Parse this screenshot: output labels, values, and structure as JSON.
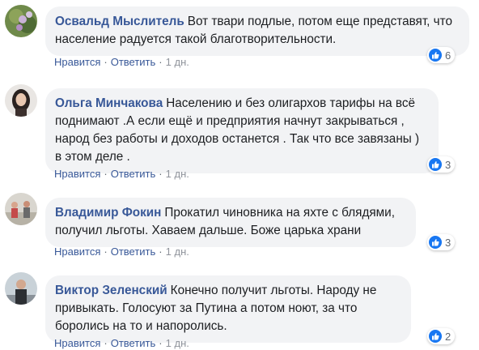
{
  "comments": [
    {
      "author": "Освальд Мыслитель",
      "text": "Вот твари подлые, потом еще представят, что население радуется такой благотворительности.",
      "actions": {
        "like": "Нравится",
        "reply": "Ответить",
        "separator": "·",
        "time": "1 дн."
      },
      "reactions": {
        "icon": "like-icon",
        "count": "6"
      }
    },
    {
      "author": "Ольга Минчакова",
      "text": "Населению и без олигархов тарифы на всё поднимают .А если ещё и предприятия начнут закрываться , народ без работы и доходов останется . Так что все завязаны ) в этом деле .",
      "actions": {
        "like": "Нравится",
        "reply": "Ответить",
        "separator": "·",
        "time": "1 дн."
      },
      "reactions": {
        "icon": "like-icon",
        "count": "3"
      }
    },
    {
      "author": "Владимир Фокин",
      "text": "Прокатил чиновника на яхте с блядями, получил льготы. Хаваем дальше. Боже царька храни",
      "actions": {
        "like": "Нравится",
        "reply": "Ответить",
        "separator": "·",
        "time": "1 дн."
      },
      "reactions": {
        "icon": "like-icon",
        "count": "3"
      }
    },
    {
      "author": "Виктор Зеленский",
      "text": "Конечно получит льготы. Народу не привыкать. Голосуют за Путина а потом ноют, за что боролись на то и напоролись.",
      "actions": {
        "like": "Нравится",
        "reply": "Ответить",
        "separator": "·",
        "time": "1 дн."
      },
      "reactions": {
        "icon": "like-icon",
        "count": "2"
      }
    }
  ],
  "colors": {
    "author": "#385898",
    "bubble": "#f2f3f5",
    "like_badge": "#1877f2",
    "meta": "#606770"
  }
}
